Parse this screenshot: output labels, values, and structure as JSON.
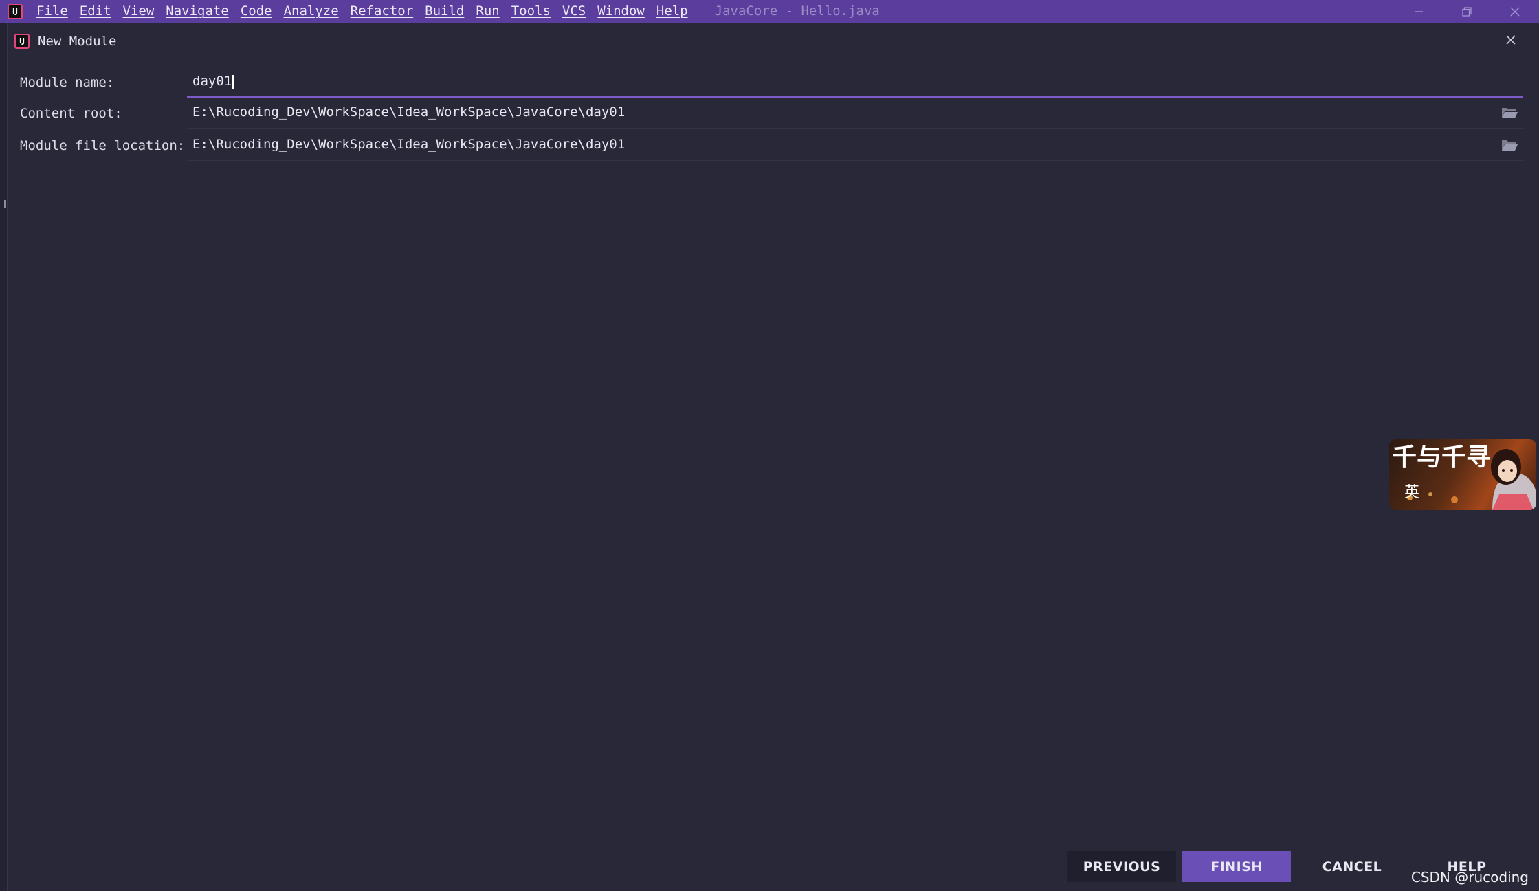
{
  "titlebar": {
    "menu": [
      {
        "label": "File"
      },
      {
        "label": "Edit"
      },
      {
        "label": "View"
      },
      {
        "label": "Navigate"
      },
      {
        "label": "Code"
      },
      {
        "label": "Analyze"
      },
      {
        "label": "Refactor"
      },
      {
        "label": "Build"
      },
      {
        "label": "Run"
      },
      {
        "label": "Tools"
      },
      {
        "label": "VCS"
      },
      {
        "label": "Window"
      },
      {
        "label": "Help"
      }
    ],
    "window_title": "JavaCore - Hello.java",
    "logo_text": "IJ"
  },
  "dialog": {
    "title": "New Module",
    "fields": {
      "module_name": {
        "label": "Module name:",
        "value": "day01"
      },
      "content_root": {
        "label": "Content root:",
        "value": "E:\\Rucoding_Dev\\WorkSpace\\Idea_WorkSpace\\JavaCore\\day01"
      },
      "module_file_location": {
        "label": "Module file location:",
        "value": "E:\\Rucoding_Dev\\WorkSpace\\Idea_WorkSpace\\JavaCore\\day01"
      }
    },
    "buttons": {
      "previous": "PREVIOUS",
      "finish": "FINISH",
      "cancel": "CANCEL",
      "help": "HELP"
    }
  },
  "sticker": {
    "text_top": "千与千寻",
    "text_bottom": "英"
  },
  "watermark": "CSDN @rucoding",
  "colors": {
    "titlebar": "#5b3d9e",
    "background": "#282838",
    "accent": "#7d5bc9",
    "finish_button": "#6a4fb6"
  }
}
